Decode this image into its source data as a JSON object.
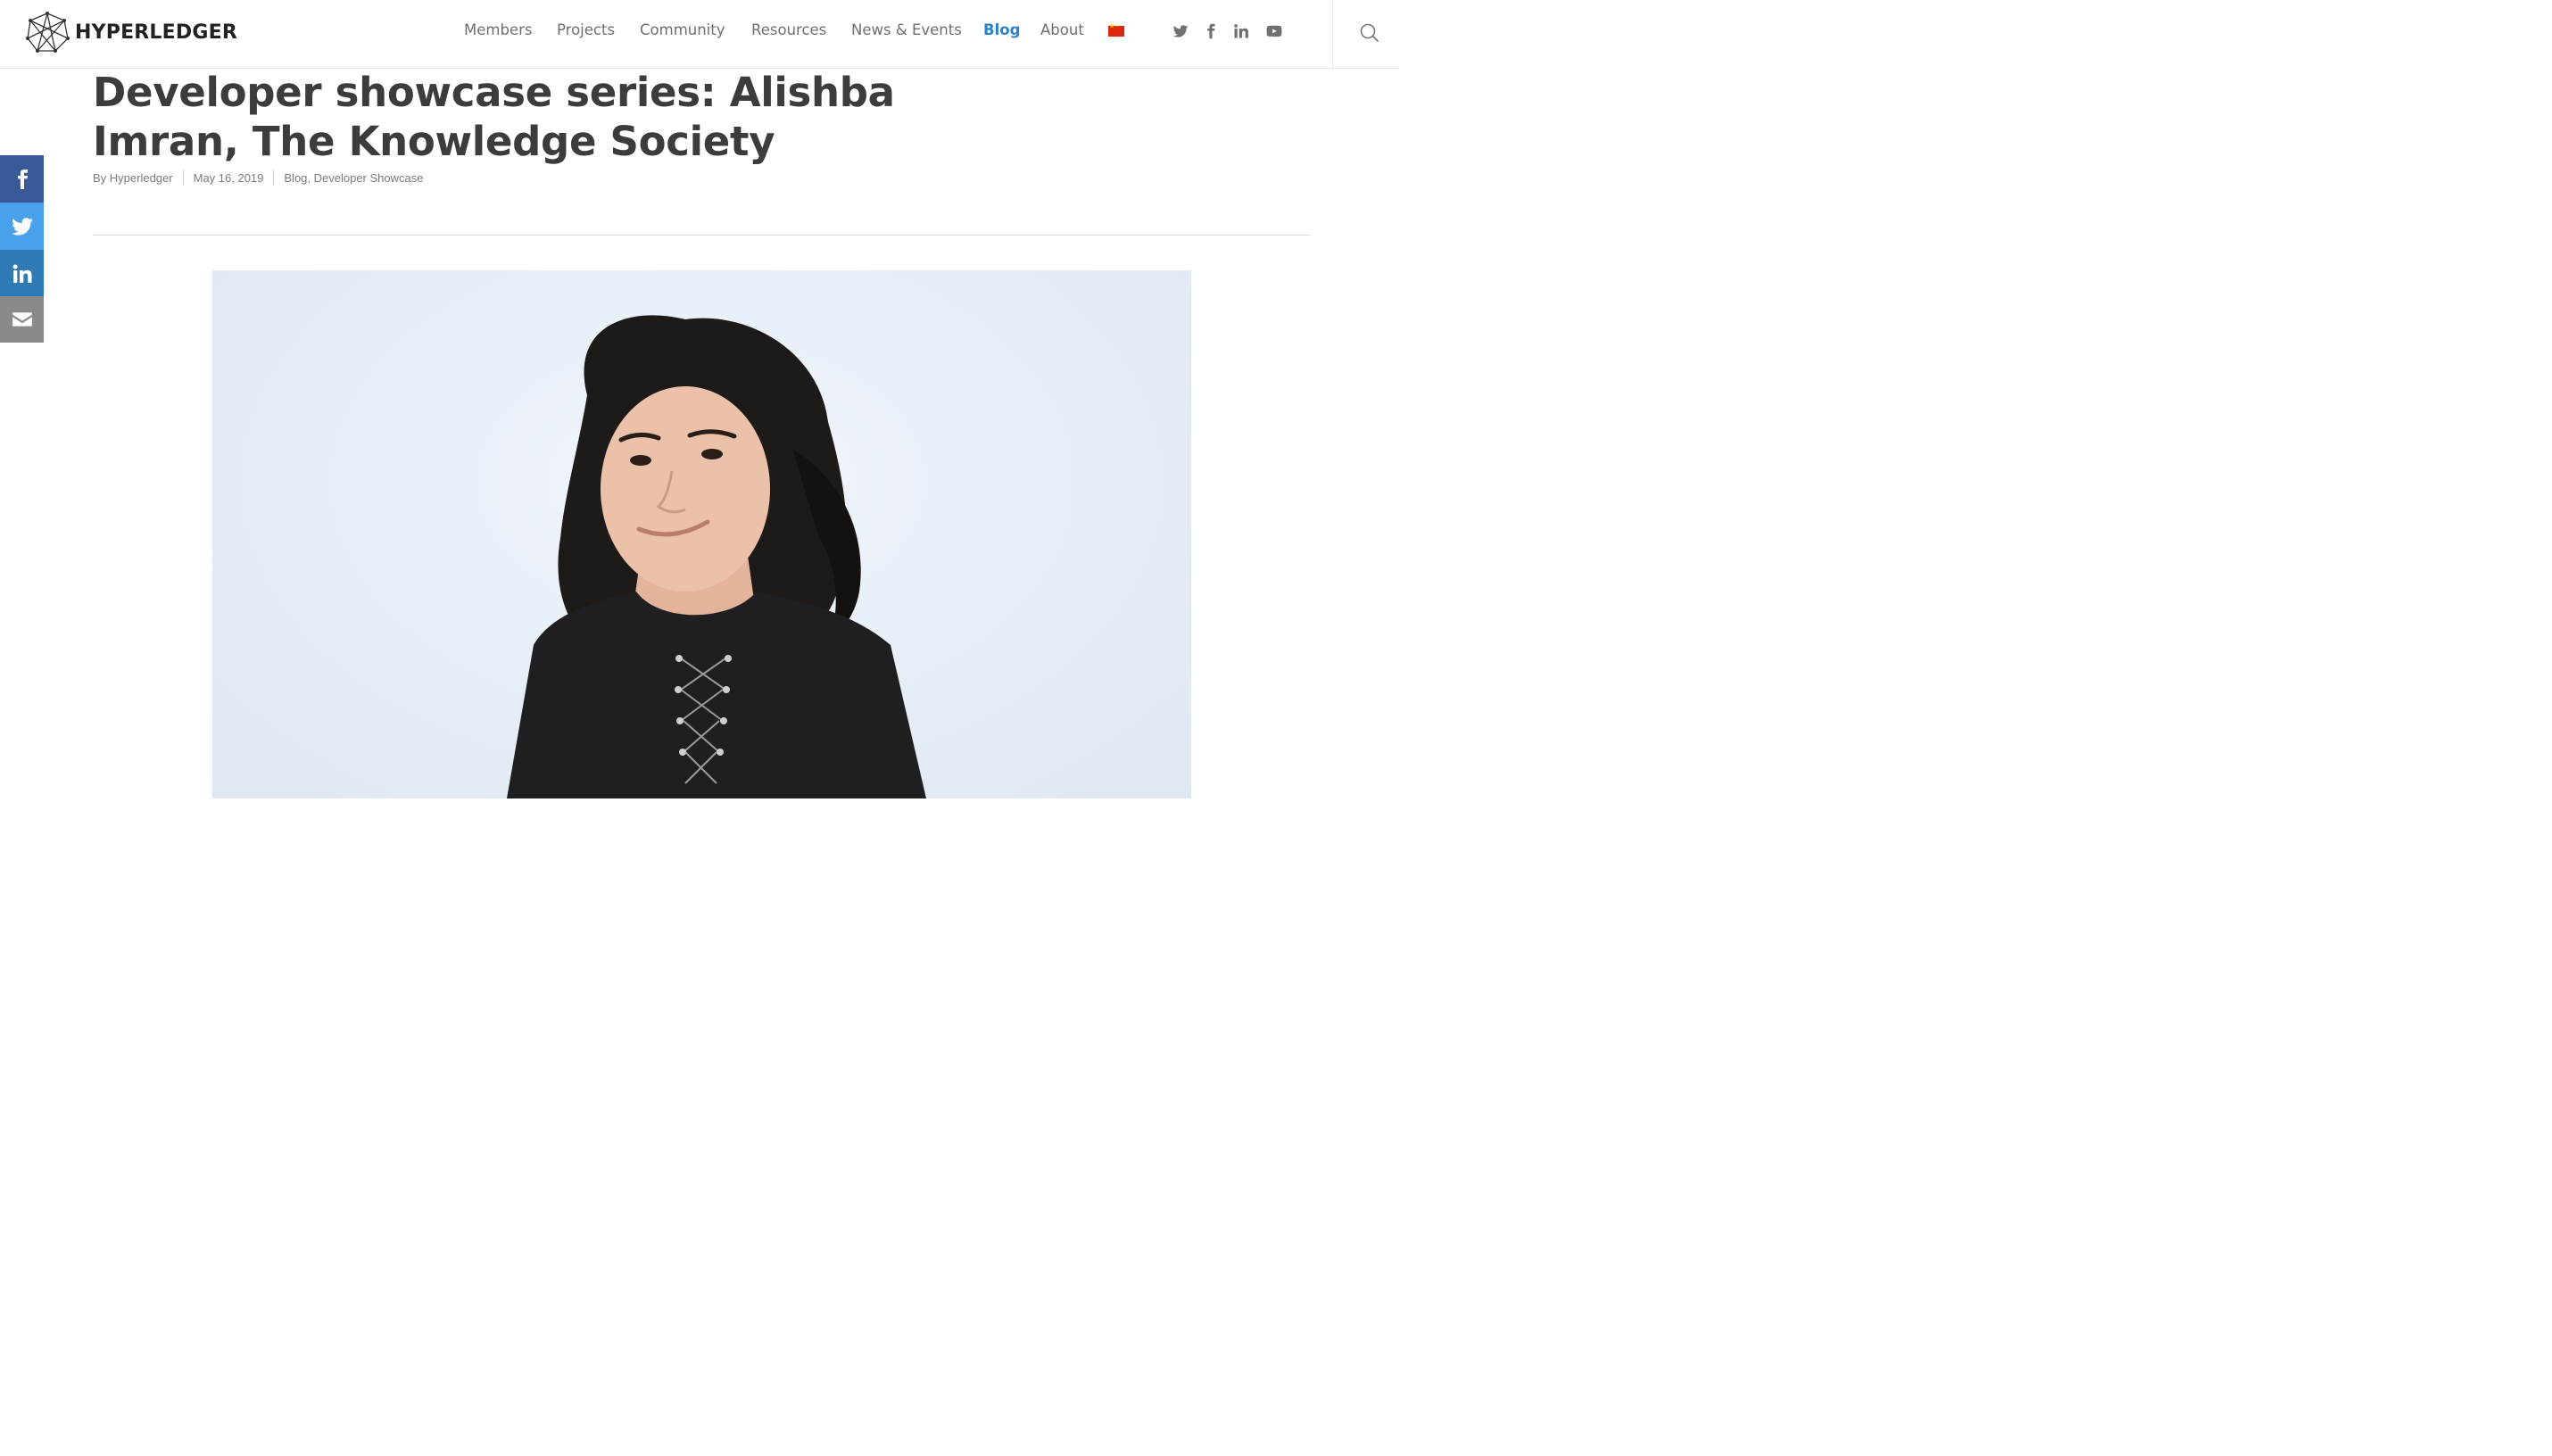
{
  "header": {
    "logo_text": "HYPERLEDGER",
    "nav": [
      {
        "label": "Members",
        "active": false
      },
      {
        "label": "Projects",
        "active": false
      },
      {
        "label": "Community",
        "active": false
      },
      {
        "label": "Resources",
        "active": false
      },
      {
        "label": "News & Events",
        "active": false
      },
      {
        "label": "Blog",
        "active": true
      },
      {
        "label": "About",
        "active": false
      }
    ],
    "language_flag": "china-flag-icon",
    "social_icons": [
      "twitter-icon",
      "facebook-icon",
      "linkedin-icon",
      "youtube-icon"
    ],
    "search_icon": "search-icon"
  },
  "share_bar": [
    "facebook-icon",
    "twitter-icon",
    "linkedin-icon",
    "email-icon"
  ],
  "colors": {
    "accent": "#2a83c6",
    "facebook": "#3b5998",
    "twitter": "#4aa1eb",
    "linkedin": "#2f79b4",
    "email": "#8a8a8a",
    "title": "#3c3c3c"
  },
  "article": {
    "title": "Developer showcase series: Alishba Imran, The Knowledge Society",
    "author": "By Hyperledger",
    "date": "May 16, 2019",
    "categories": "Blog, Developer Showcase"
  }
}
